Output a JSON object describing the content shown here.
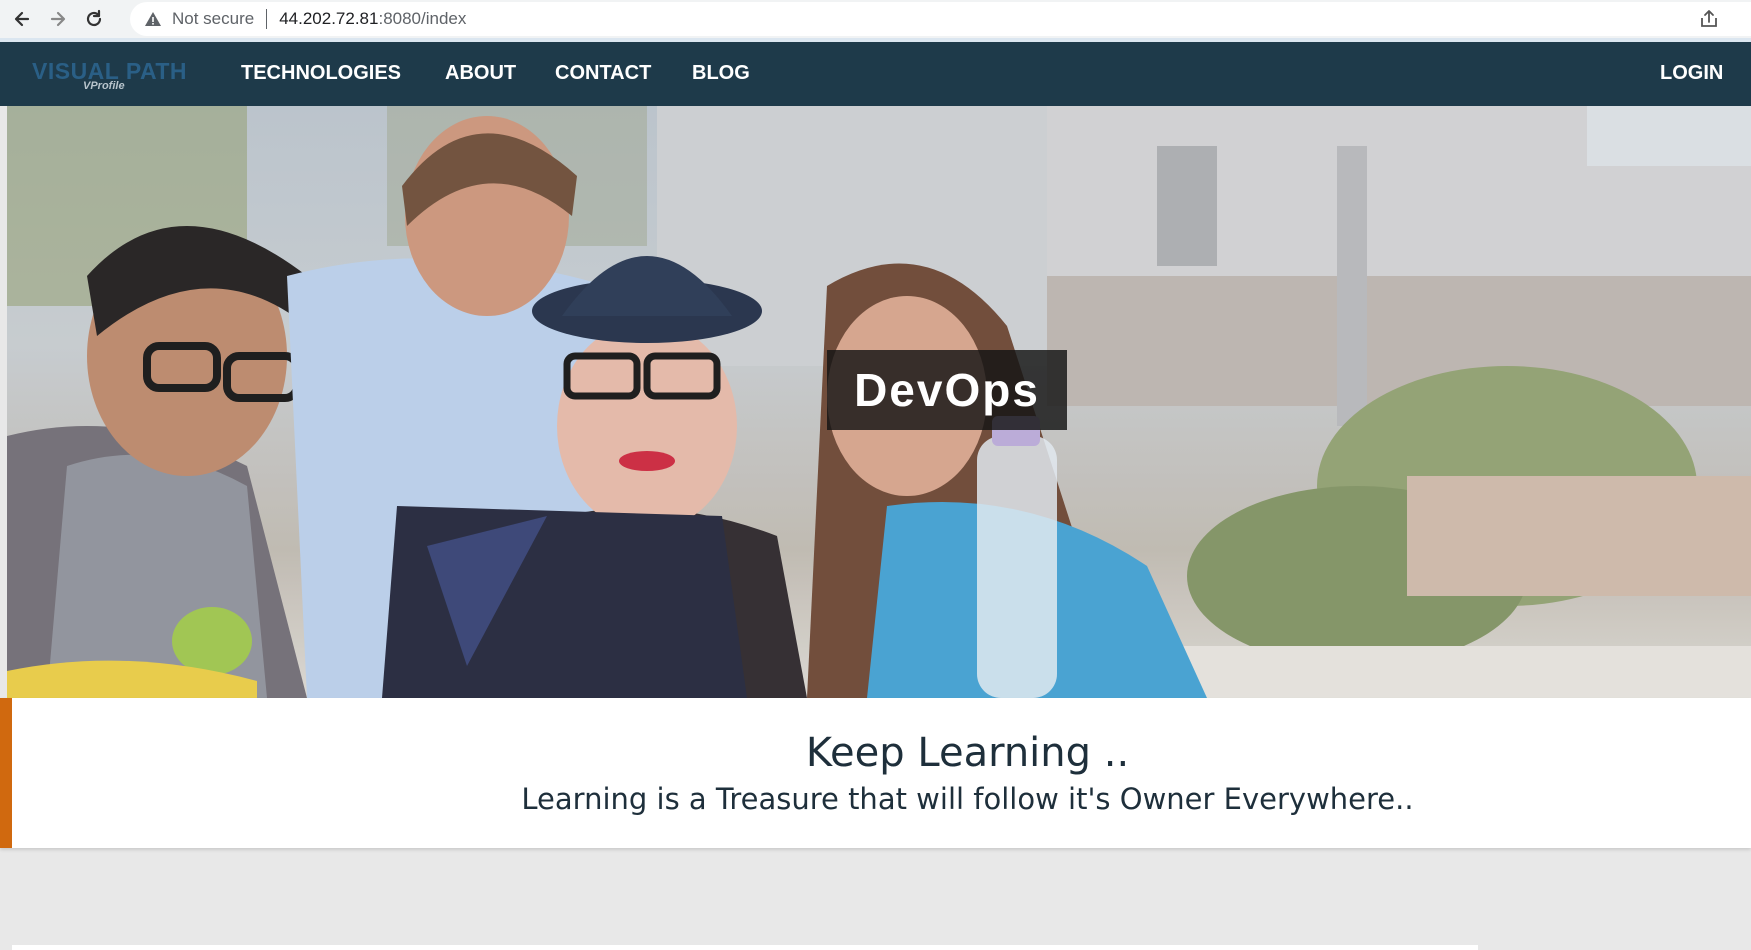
{
  "browser": {
    "security_label": "Not secure",
    "url_host": "44.202.72.81",
    "url_rest": ":8080/index"
  },
  "site": {
    "logo_main": "VISUAL PATH",
    "logo_sub": "VProfile",
    "nav_items": [
      "TECHNOLOGIES",
      "ABOUT",
      "CONTACT",
      "BLOG"
    ],
    "login": "LOGIN"
  },
  "hero": {
    "badge": "DevOps"
  },
  "quote": {
    "title": "Keep Learning ..",
    "subtitle": "Learning is a Treasure that will follow it's Owner Everywhere.."
  },
  "colors": {
    "nav_bg": "#1e3a4a",
    "accent": "#d0690f",
    "logo": "#2a5f86"
  }
}
